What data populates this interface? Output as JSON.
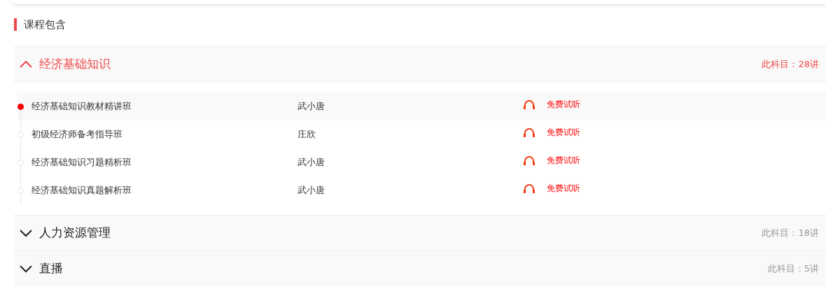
{
  "heading": "课程包含",
  "subjects": [
    {
      "title": "经济基础知识",
      "count": "此科目：28讲",
      "expanded": true,
      "lessons": [
        {
          "title": "经济基础知识教材精讲班",
          "teacher": "武小唐",
          "action": "免费试听",
          "selected": true
        },
        {
          "title": "初级经济师备考指导班",
          "teacher": "庄欣",
          "action": "免费试听",
          "selected": false
        },
        {
          "title": "经济基础知识习题精析班",
          "teacher": "武小唐",
          "action": "免费试听",
          "selected": false
        },
        {
          "title": "经济基础知识真题解析班",
          "teacher": "武小唐",
          "action": "免费试听",
          "selected": false
        }
      ]
    },
    {
      "title": "人力资源管理",
      "count": "此科目：18讲",
      "expanded": false
    },
    {
      "title": "直播",
      "count": "此科目：5讲",
      "expanded": false
    }
  ]
}
